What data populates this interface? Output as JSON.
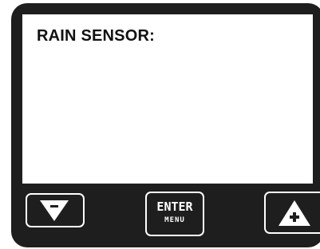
{
  "screen": {
    "title": "RAIN SENSOR:"
  },
  "buttons": {
    "down": {
      "icon": "triangle-down-minus-icon"
    },
    "enter": {
      "label": "ENTER",
      "sublabel": "MENU"
    },
    "up": {
      "icon": "triangle-up-plus-icon"
    }
  },
  "colors": {
    "bezel": "#1e1e1e",
    "screen": "#ffffff",
    "text": "#111111"
  }
}
